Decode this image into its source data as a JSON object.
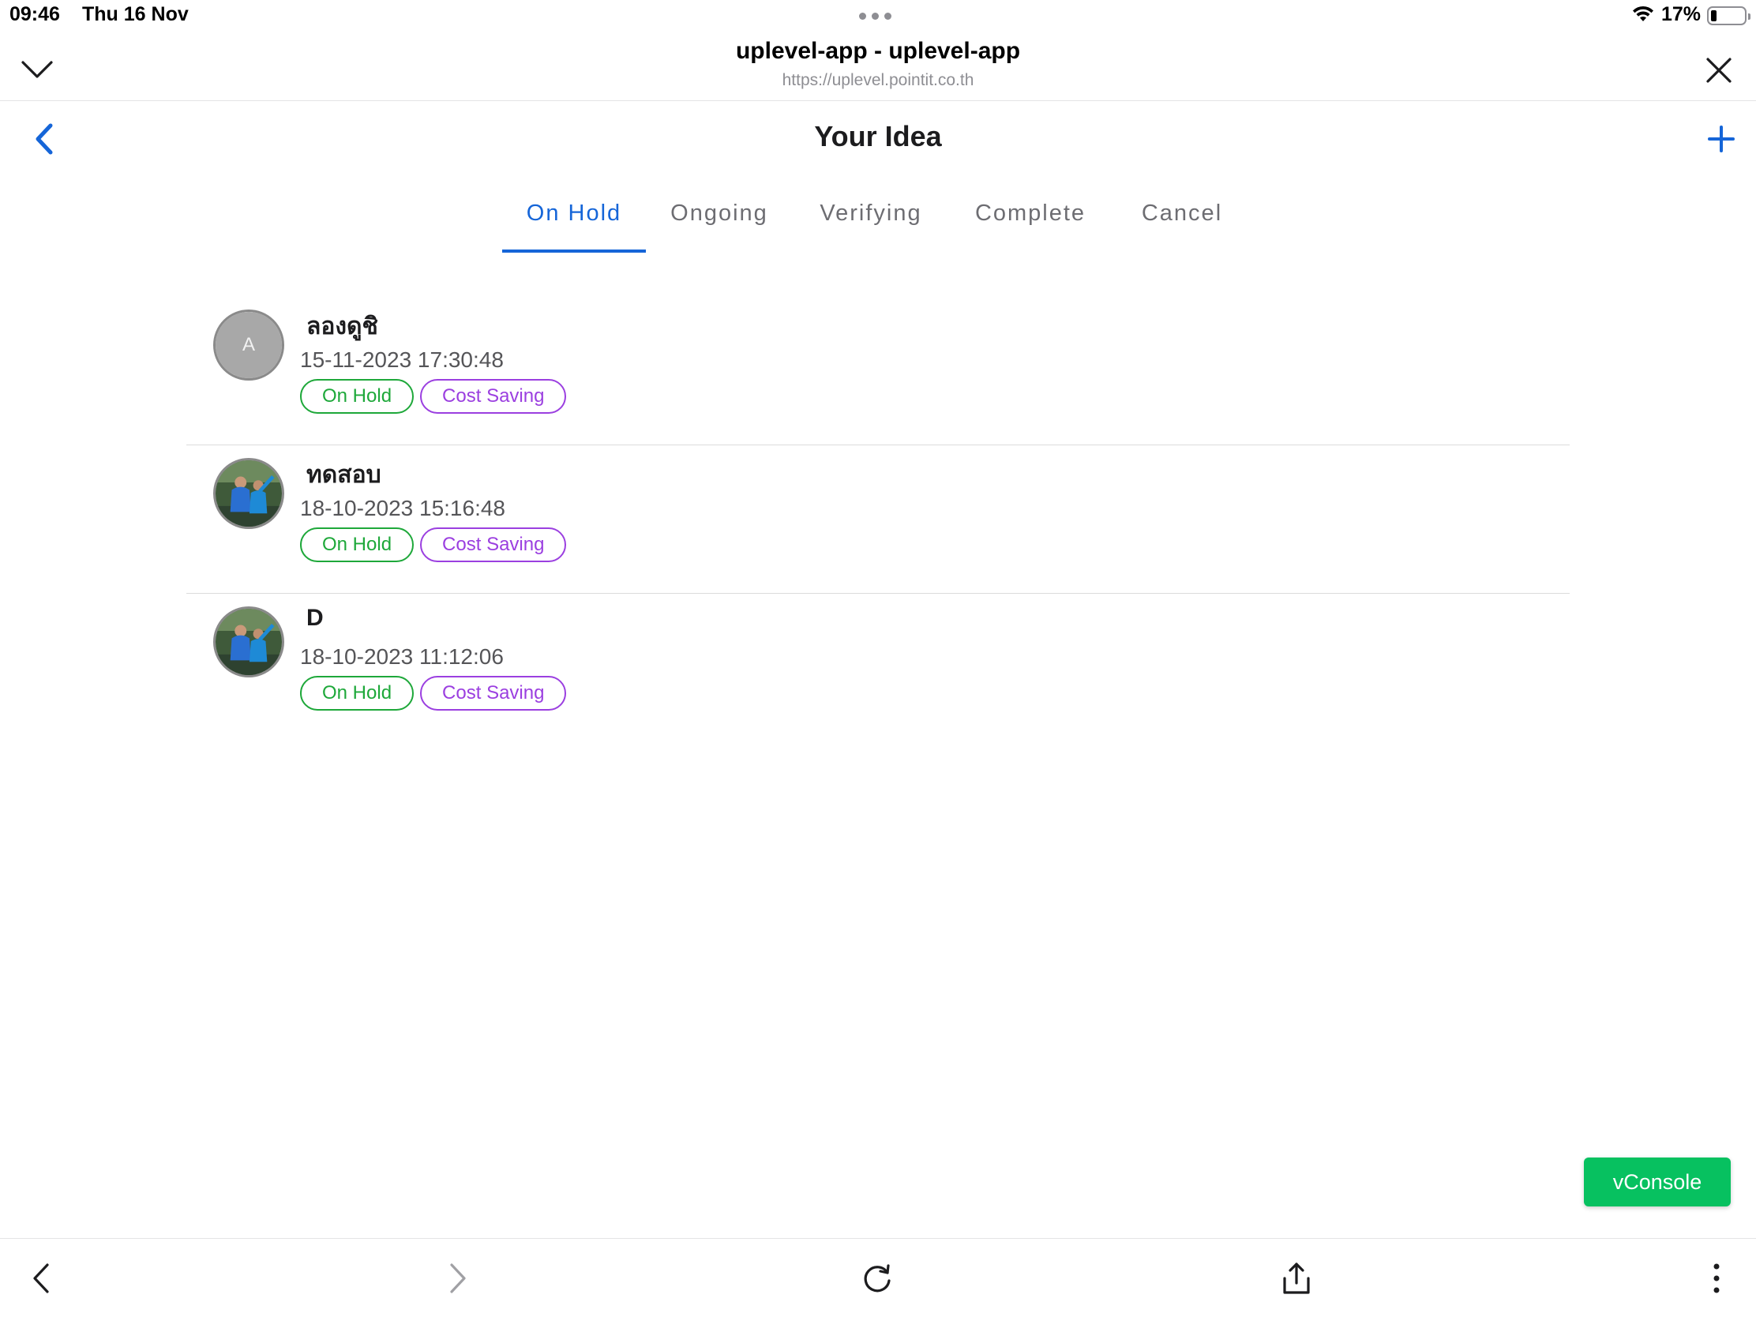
{
  "status_bar": {
    "time": "09:46",
    "date": "Thu 16 Nov",
    "battery": "17%"
  },
  "browser": {
    "title": "uplevel-app - uplevel-app",
    "url": "https://uplevel.pointit.co.th"
  },
  "page": {
    "title": "Your Idea"
  },
  "tabs": [
    {
      "label": "On Hold",
      "active": true
    },
    {
      "label": "Ongoing",
      "active": false
    },
    {
      "label": "Verifying",
      "active": false
    },
    {
      "label": "Complete",
      "active": false
    },
    {
      "label": "Cancel",
      "active": false
    }
  ],
  "ideas": [
    {
      "name": "ลองดูชิ",
      "date": "15-11-2023 17:30:48",
      "avatar_letter": "A",
      "avatar_type": "letter",
      "status": "On Hold",
      "category": "Cost Saving"
    },
    {
      "name": "ทดสอบ",
      "date": "18-10-2023 15:16:48",
      "avatar_type": "photo",
      "status": "On Hold",
      "category": "Cost Saving"
    },
    {
      "name": "D",
      "date": "18-10-2023 11:12:06",
      "avatar_type": "photo",
      "status": "On Hold",
      "category": "Cost Saving"
    }
  ],
  "vconsole": {
    "label": "vConsole"
  },
  "colors": {
    "accent": "#1565d8",
    "status_green": "#1ea83a",
    "category_purple": "#9b3fe0",
    "vconsole_green": "#07c160"
  },
  "icons": {
    "collapse": "chevron-down-icon",
    "close": "close-icon",
    "back": "chevron-left-icon",
    "add": "plus-icon",
    "browser_back": "chevron-left-icon",
    "browser_forward": "chevron-right-icon",
    "reload": "reload-icon",
    "share": "share-icon",
    "more": "more-vertical-icon"
  }
}
